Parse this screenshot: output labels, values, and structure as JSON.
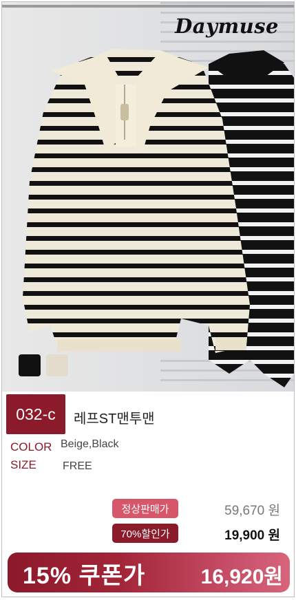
{
  "brand": "Daymuse",
  "product": {
    "code": "032-c",
    "name": "레프ST맨투맨",
    "swatches": [
      "#111111",
      "#e3dccd"
    ]
  },
  "options": {
    "color_label": "COLOR",
    "color_value": "Beige,Black",
    "size_label": "SIZE",
    "size_value": "FREE"
  },
  "pricing": {
    "regular_label": "정상판매가",
    "regular_price": "59,670 원",
    "sale_label": "70%할인가",
    "sale_price": "19,900 원"
  },
  "coupon": {
    "label": "15% 쿠폰가",
    "price": "16,920원"
  },
  "colors": {
    "accent": "#8b1a2a",
    "pink": "#d6566a"
  }
}
